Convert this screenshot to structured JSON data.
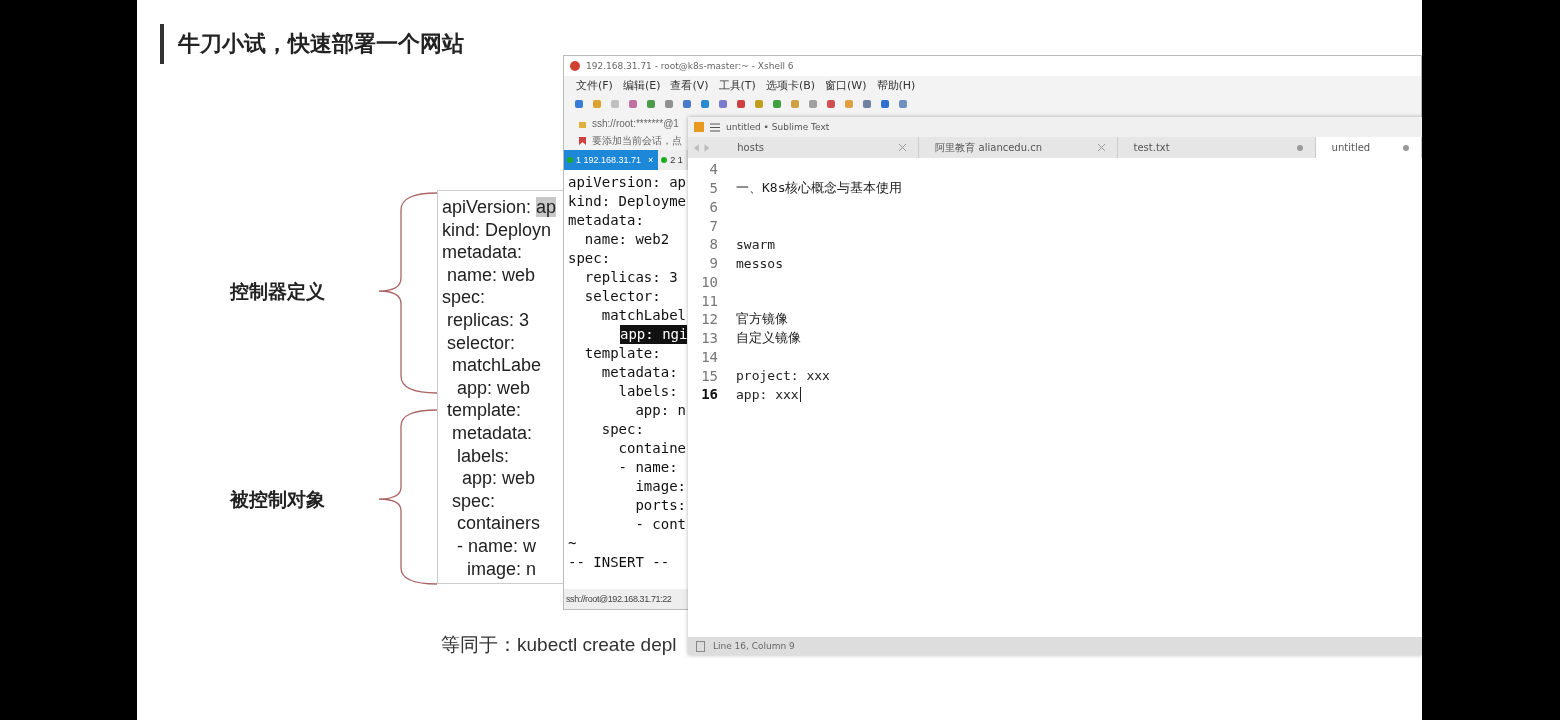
{
  "slide": {
    "title": "牛刀小试，快速部署一个网站",
    "labels": [
      "控制器定义",
      "被控制对象"
    ],
    "yaml": [
      {
        "text": "apiVersion: ",
        "highlight": "ap"
      },
      {
        "text": "kind: Deployn"
      },
      {
        "text": "metadata:"
      },
      {
        "text": " name: web"
      },
      {
        "text": "spec:"
      },
      {
        "text": " replicas: 3"
      },
      {
        "text": " selector:"
      },
      {
        "text": "  matchLabe"
      },
      {
        "text": "   app: web"
      },
      {
        "text": " template:"
      },
      {
        "text": "  metadata:"
      },
      {
        "text": "   labels:"
      },
      {
        "text": "    app: web"
      },
      {
        "text": "  spec:"
      },
      {
        "text": "   containers"
      },
      {
        "text": "   - name: w"
      },
      {
        "text": "     image: n"
      }
    ],
    "caption": "等同于：kubectl create depl"
  },
  "xshell": {
    "title": "192.168.31.71 - root@k8s-master:~ - Xshell 6",
    "menu": [
      "文件(F)",
      "编辑(E)",
      "查看(V)",
      "工具(T)",
      "选项卡(B)",
      "窗口(W)",
      "帮助(H)"
    ],
    "address": "ssh://root:*******@1",
    "hint": "要添加当前会话，点",
    "tabs": [
      {
        "label": "1 192.168.31.71",
        "selected": true,
        "close": "×"
      },
      {
        "label": "2 1",
        "selected": false
      }
    ],
    "terminal": [
      {
        "text": "apiVersion: ap",
        "highlighted": false
      },
      {
        "text": "kind: Deployme",
        "highlighted": false
      },
      {
        "text": "metadata:",
        "highlighted": false
      },
      {
        "text": "  name: web2",
        "highlighted": false
      },
      {
        "text": "spec:",
        "highlighted": false
      },
      {
        "text": "  replicas: 3",
        "highlighted": false
      },
      {
        "text": "  selector:",
        "highlighted": false
      },
      {
        "text": "    matchLabel",
        "highlighted": false
      },
      {
        "text": "      app: ngi",
        "highlighted": true
      },
      {
        "text": "  template:",
        "highlighted": false
      },
      {
        "text": "    metadata:",
        "highlighted": false
      },
      {
        "text": "      labels:",
        "highlighted": false
      },
      {
        "text": "        app: n",
        "highlighted": false
      },
      {
        "text": "    spec:",
        "highlighted": false
      },
      {
        "text": "      containe",
        "highlighted": false
      },
      {
        "text": "      - name:",
        "highlighted": false
      },
      {
        "text": "        image:",
        "highlighted": false
      },
      {
        "text": "        ports:",
        "highlighted": false
      },
      {
        "text": "        - cont",
        "highlighted": false
      },
      {
        "text": "~",
        "highlighted": false
      },
      {
        "text": "-- INSERT --",
        "highlighted": false
      }
    ],
    "status": "ssh://root@192.168.31.71:22"
  },
  "sublime": {
    "title": "untitled • Sublime Text",
    "tabs": [
      {
        "label": "hosts",
        "selected": false,
        "modified": false
      },
      {
        "label": "阿里教育 aliancedu.cn",
        "selected": false,
        "modified": false
      },
      {
        "label": "test.txt",
        "selected": false,
        "modified": true
      },
      {
        "label": "untitled",
        "selected": true,
        "modified": true
      }
    ],
    "lines": [
      {
        "number": "4",
        "current": false
      },
      {
        "number": "5",
        "text": "一、K8s核心概念与基本使用",
        "current": false
      },
      {
        "number": "6",
        "current": false
      },
      {
        "number": "7",
        "current": false
      },
      {
        "number": "8",
        "text": "swarm",
        "current": false
      },
      {
        "number": "9",
        "text": "messos",
        "current": false
      },
      {
        "number": "10",
        "current": false
      },
      {
        "number": "11",
        "current": false
      },
      {
        "number": "12",
        "text": "官方镜像",
        "current": false
      },
      {
        "number": "13",
        "text": "自定义镜像",
        "current": false
      },
      {
        "number": "14",
        "current": false
      },
      {
        "number": "15",
        "text": "project: xxx",
        "current": false
      },
      {
        "number": "16",
        "text": "app: xxx",
        "current": true
      }
    ],
    "status": "Line 16, Column 9"
  }
}
